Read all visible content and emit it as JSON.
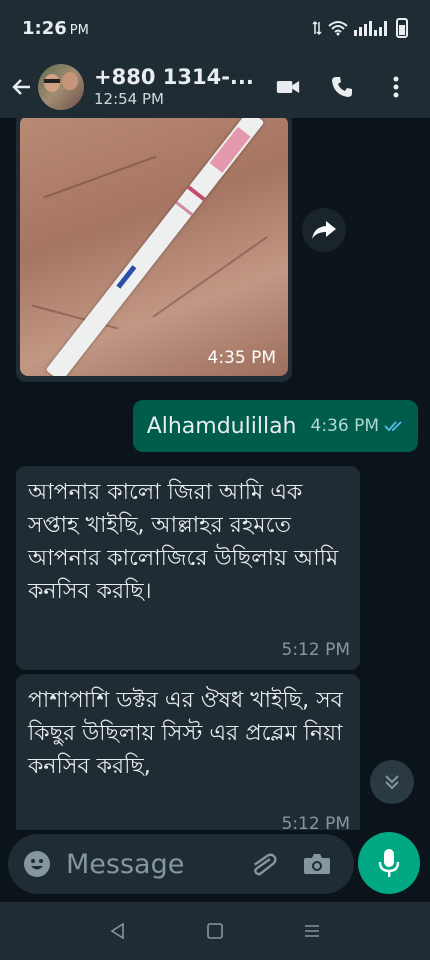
{
  "status_bar": {
    "time": "1:26",
    "ampm": "PM"
  },
  "header": {
    "contact_name": "+880 1314-...",
    "contact_subtitle": "12:54 PM"
  },
  "messages": [
    {
      "type": "image",
      "direction": "in",
      "time": "4:35 PM"
    },
    {
      "type": "text",
      "direction": "out",
      "text": "Alhamdulillah",
      "time": "4:36 PM",
      "status": "read"
    },
    {
      "type": "text",
      "direction": "in",
      "text": "আপনার কালো জিরা আমি এক সপ্তাহ খাইছি,  আল্লাহর রহমতে আপনার কালোজিরে উছিলায় আমি কনসিব করছি।",
      "time": "5:12 PM"
    },
    {
      "type": "text",
      "direction": "in",
      "text": "পাশাপাশি ডক্টর এর ঔষধ খাইছি, সব কিছুর উছিলায় সিস্ট এর প্রব্লেম নিয়া কনসিব করছি,",
      "time": "5:12 PM"
    }
  ],
  "composer": {
    "placeholder": "Message"
  },
  "colors": {
    "background": "#0b141a",
    "bar": "#1f2c34",
    "incoming_bubble": "#202c33",
    "outgoing_bubble": "#005c4b",
    "accent": "#00a884",
    "read_ticks": "#53bdeb"
  },
  "icons": {
    "back": "arrow-left-icon",
    "video": "video-call-icon",
    "call": "phone-icon",
    "menu": "more-vert-icon",
    "forward": "forward-icon",
    "scroll": "chevrons-down-icon",
    "emoji": "emoji-icon",
    "attach": "paperclip-icon",
    "camera": "camera-icon",
    "mic": "mic-icon"
  }
}
